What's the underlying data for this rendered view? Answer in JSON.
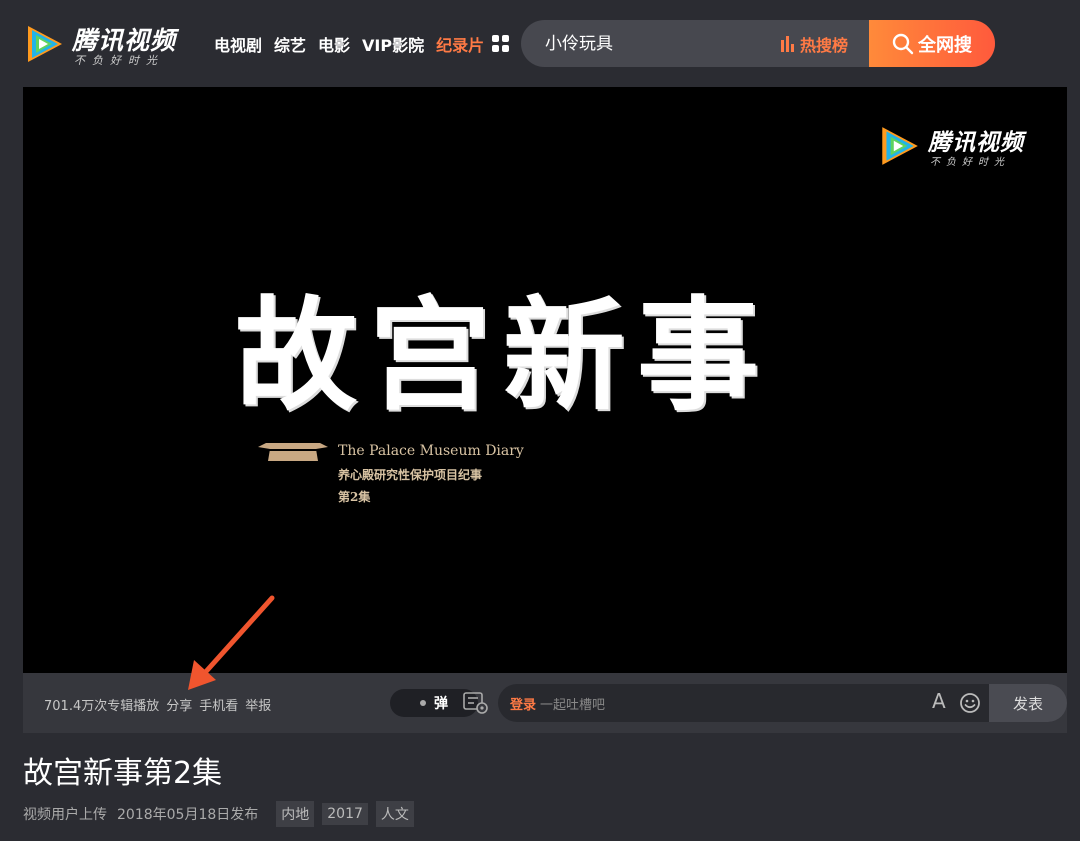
{
  "header": {
    "logo": {
      "name": "腾讯视频",
      "slogan": "不负好时光"
    },
    "nav": [
      {
        "label": "电视剧",
        "active": false
      },
      {
        "label": "综艺",
        "active": false
      },
      {
        "label": "电影",
        "active": false
      },
      {
        "label": "VIP影院",
        "active": false
      },
      {
        "label": "纪录片",
        "active": true
      }
    ],
    "search": {
      "value": "小伶玩具",
      "hot_label": "热搜榜",
      "button_label": "全网搜"
    }
  },
  "player": {
    "watermark": {
      "name": "腾讯视频",
      "slogan": "不负好时光"
    },
    "title_art": "故宫新事",
    "subtitle_en": "The Palace Museum Diary",
    "subtitle_cn": "养心殿研究性保护项目纪事",
    "episode": "第2集"
  },
  "bar": {
    "play_count": "701.4万次专辑播放",
    "share": "分享",
    "mobile": "手机看",
    "report": "举报",
    "danmu_toggle": "弹",
    "comment": {
      "login": "登录",
      "placeholder": "一起吐槽吧",
      "font_icon": "A",
      "post_label": "发表"
    }
  },
  "video": {
    "title": "故宫新事第2集",
    "uploader": "视频用户上传",
    "publish_date": "2018年05月18日发布",
    "tags": [
      "内地",
      "2017",
      "人文"
    ]
  },
  "colors": {
    "accent": "#ff7a45",
    "background": "#2b2c32",
    "player_bg": "#000000"
  }
}
